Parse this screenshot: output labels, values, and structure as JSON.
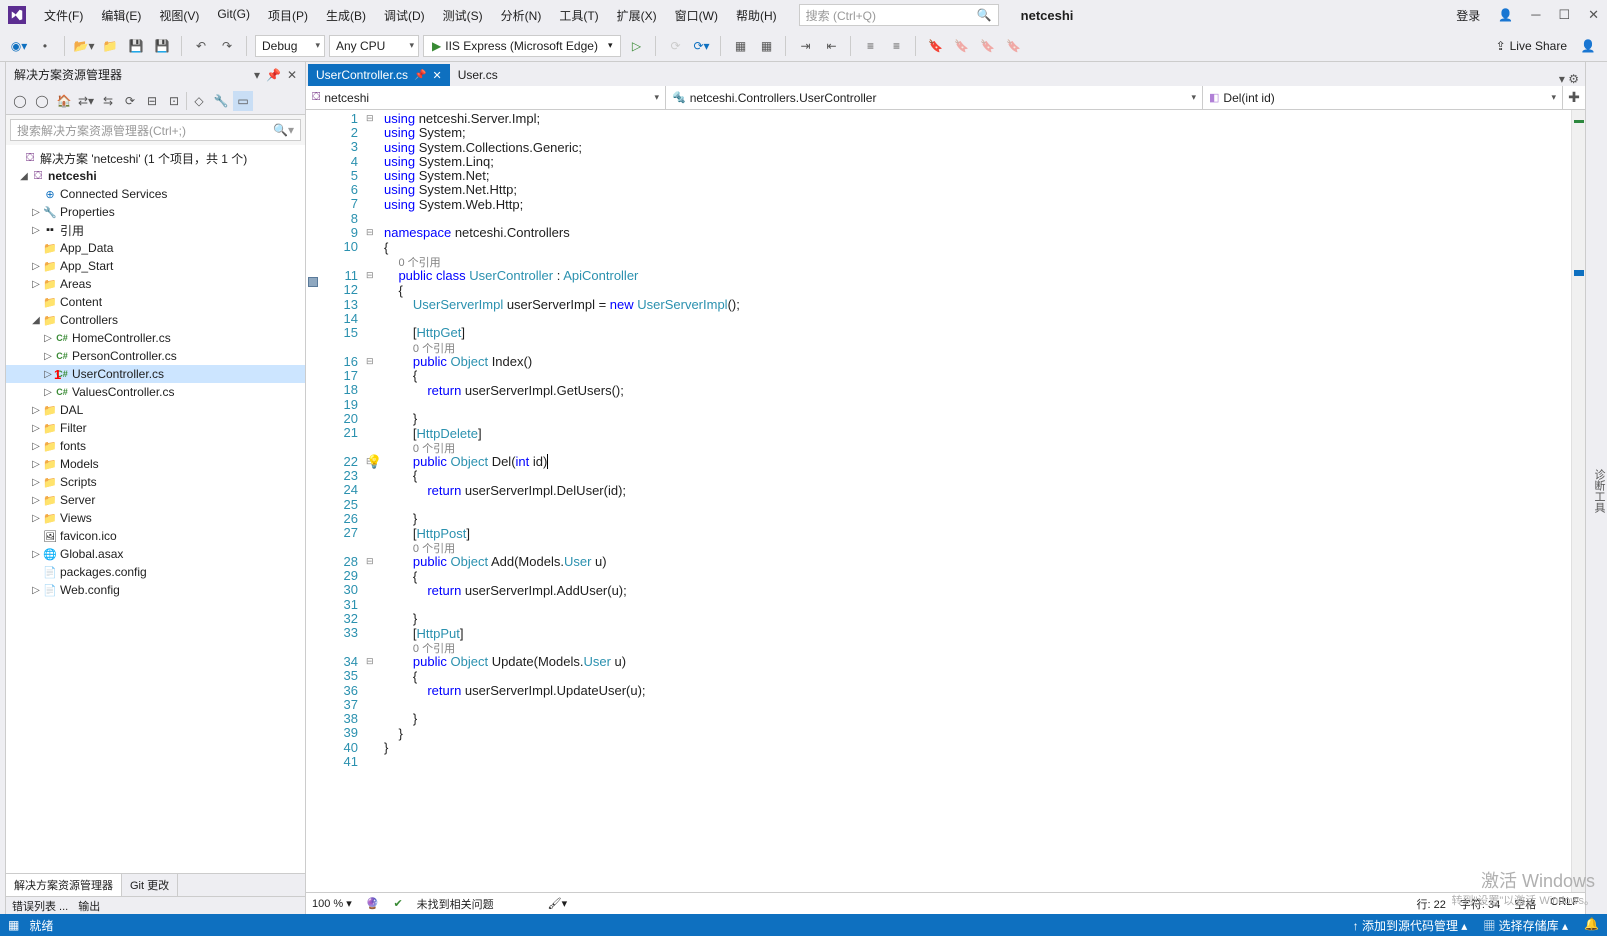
{
  "title": {
    "projectName": "netceshi",
    "login": "登录"
  },
  "menubar": {
    "file": "文件(F)",
    "edit": "编辑(E)",
    "view": "视图(V)",
    "git": "Git(G)",
    "project": "项目(P)",
    "build": "生成(B)",
    "debug": "调试(D)",
    "test": "测试(S)",
    "analyze": "分析(N)",
    "tools": "工具(T)",
    "extensions": "扩展(X)",
    "window": "窗口(W)",
    "help": "帮助(H)"
  },
  "searchPlaceholder": "搜索 (Ctrl+Q)",
  "toolbar": {
    "config": "Debug",
    "platform": "Any CPU",
    "run": "IIS Express (Microsoft Edge)",
    "liveShare": "Live Share"
  },
  "solutionExplorer": {
    "title": "解决方案资源管理器",
    "searchPlaceholder": "搜索解决方案资源管理器(Ctrl+;)",
    "solution": "解决方案 'netceshi' (1 个项目，共 1 个)",
    "project": "netceshi",
    "connectedServices": "Connected Services",
    "properties": "Properties",
    "references": "引用",
    "folders": {
      "appData": "App_Data",
      "appStart": "App_Start",
      "areas": "Areas",
      "content": "Content",
      "controllers": "Controllers",
      "dal": "DAL",
      "filter": "Filter",
      "fonts": "fonts",
      "models": "Models",
      "scripts": "Scripts",
      "server": "Server",
      "views": "Views"
    },
    "controllers": {
      "home": "HomeController.cs",
      "person": "PersonController.cs",
      "user": "UserController.cs",
      "values": "ValuesController.cs"
    },
    "files": {
      "favicon": "favicon.ico",
      "global": "Global.asax",
      "packages": "packages.config",
      "webconfig": "Web.config"
    },
    "tabs": {
      "explorer": "解决方案资源管理器",
      "git": "Git 更改"
    }
  },
  "bottomTabs": {
    "errorList": "错误列表 ...",
    "output": "输出"
  },
  "editor": {
    "tabs": {
      "active": "UserController.cs",
      "inactive": "User.cs"
    },
    "nav": {
      "project": "netceshi",
      "class": "netceshi.Controllers.UserController",
      "method": "Del(int id)"
    },
    "refText": "0 个引用",
    "status": {
      "zoom": "100 %",
      "issues": "未找到相关问题",
      "line": "行: 22",
      "col": "字符: 34",
      "space": "空格",
      "crlf": "CRLF"
    }
  },
  "statusbar": {
    "ready": "就绪",
    "sourceControl": "添加到源代码管理",
    "repo": "选择存储库"
  },
  "watermark": {
    "l1": "激活 Windows",
    "l2": "转到\"设置\"以激活 Windows。"
  },
  "rightStrip": "诊断工具"
}
